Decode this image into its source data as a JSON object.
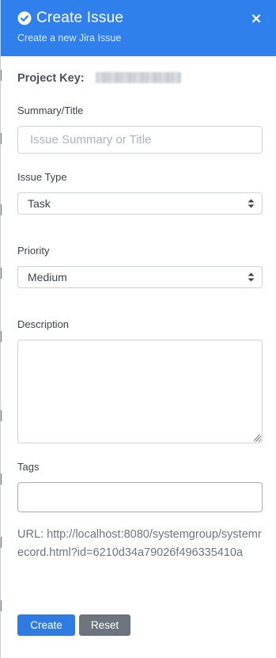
{
  "header": {
    "title": "Create Issue",
    "subtitle": "Create a new Jira Issue",
    "close_label": "×",
    "check_icon": "check-circle-icon",
    "close_icon": "close-icon",
    "background_color": "#2f80ed"
  },
  "project": {
    "label": "Project Key:",
    "value_redacted": true
  },
  "summary": {
    "label": "Summary/Title",
    "placeholder": "Issue Summary or Title",
    "value": ""
  },
  "issue_type": {
    "label": "Issue Type",
    "selected": "Task",
    "icon": "updown-chevron-icon"
  },
  "priority": {
    "label": "Priority",
    "selected": "Medium",
    "icon": "updown-chevron-icon"
  },
  "description": {
    "label": "Description",
    "value": ""
  },
  "tags": {
    "label": "Tags",
    "value": ""
  },
  "url": {
    "text": "URL: http://localhost:8080/systemgroup/systemrecord.html?id=6210d34a79026f496335410a"
  },
  "actions": {
    "create_label": "Create",
    "reset_label": "Reset",
    "create_color": "#2f7be0",
    "reset_color": "#6c757d"
  }
}
